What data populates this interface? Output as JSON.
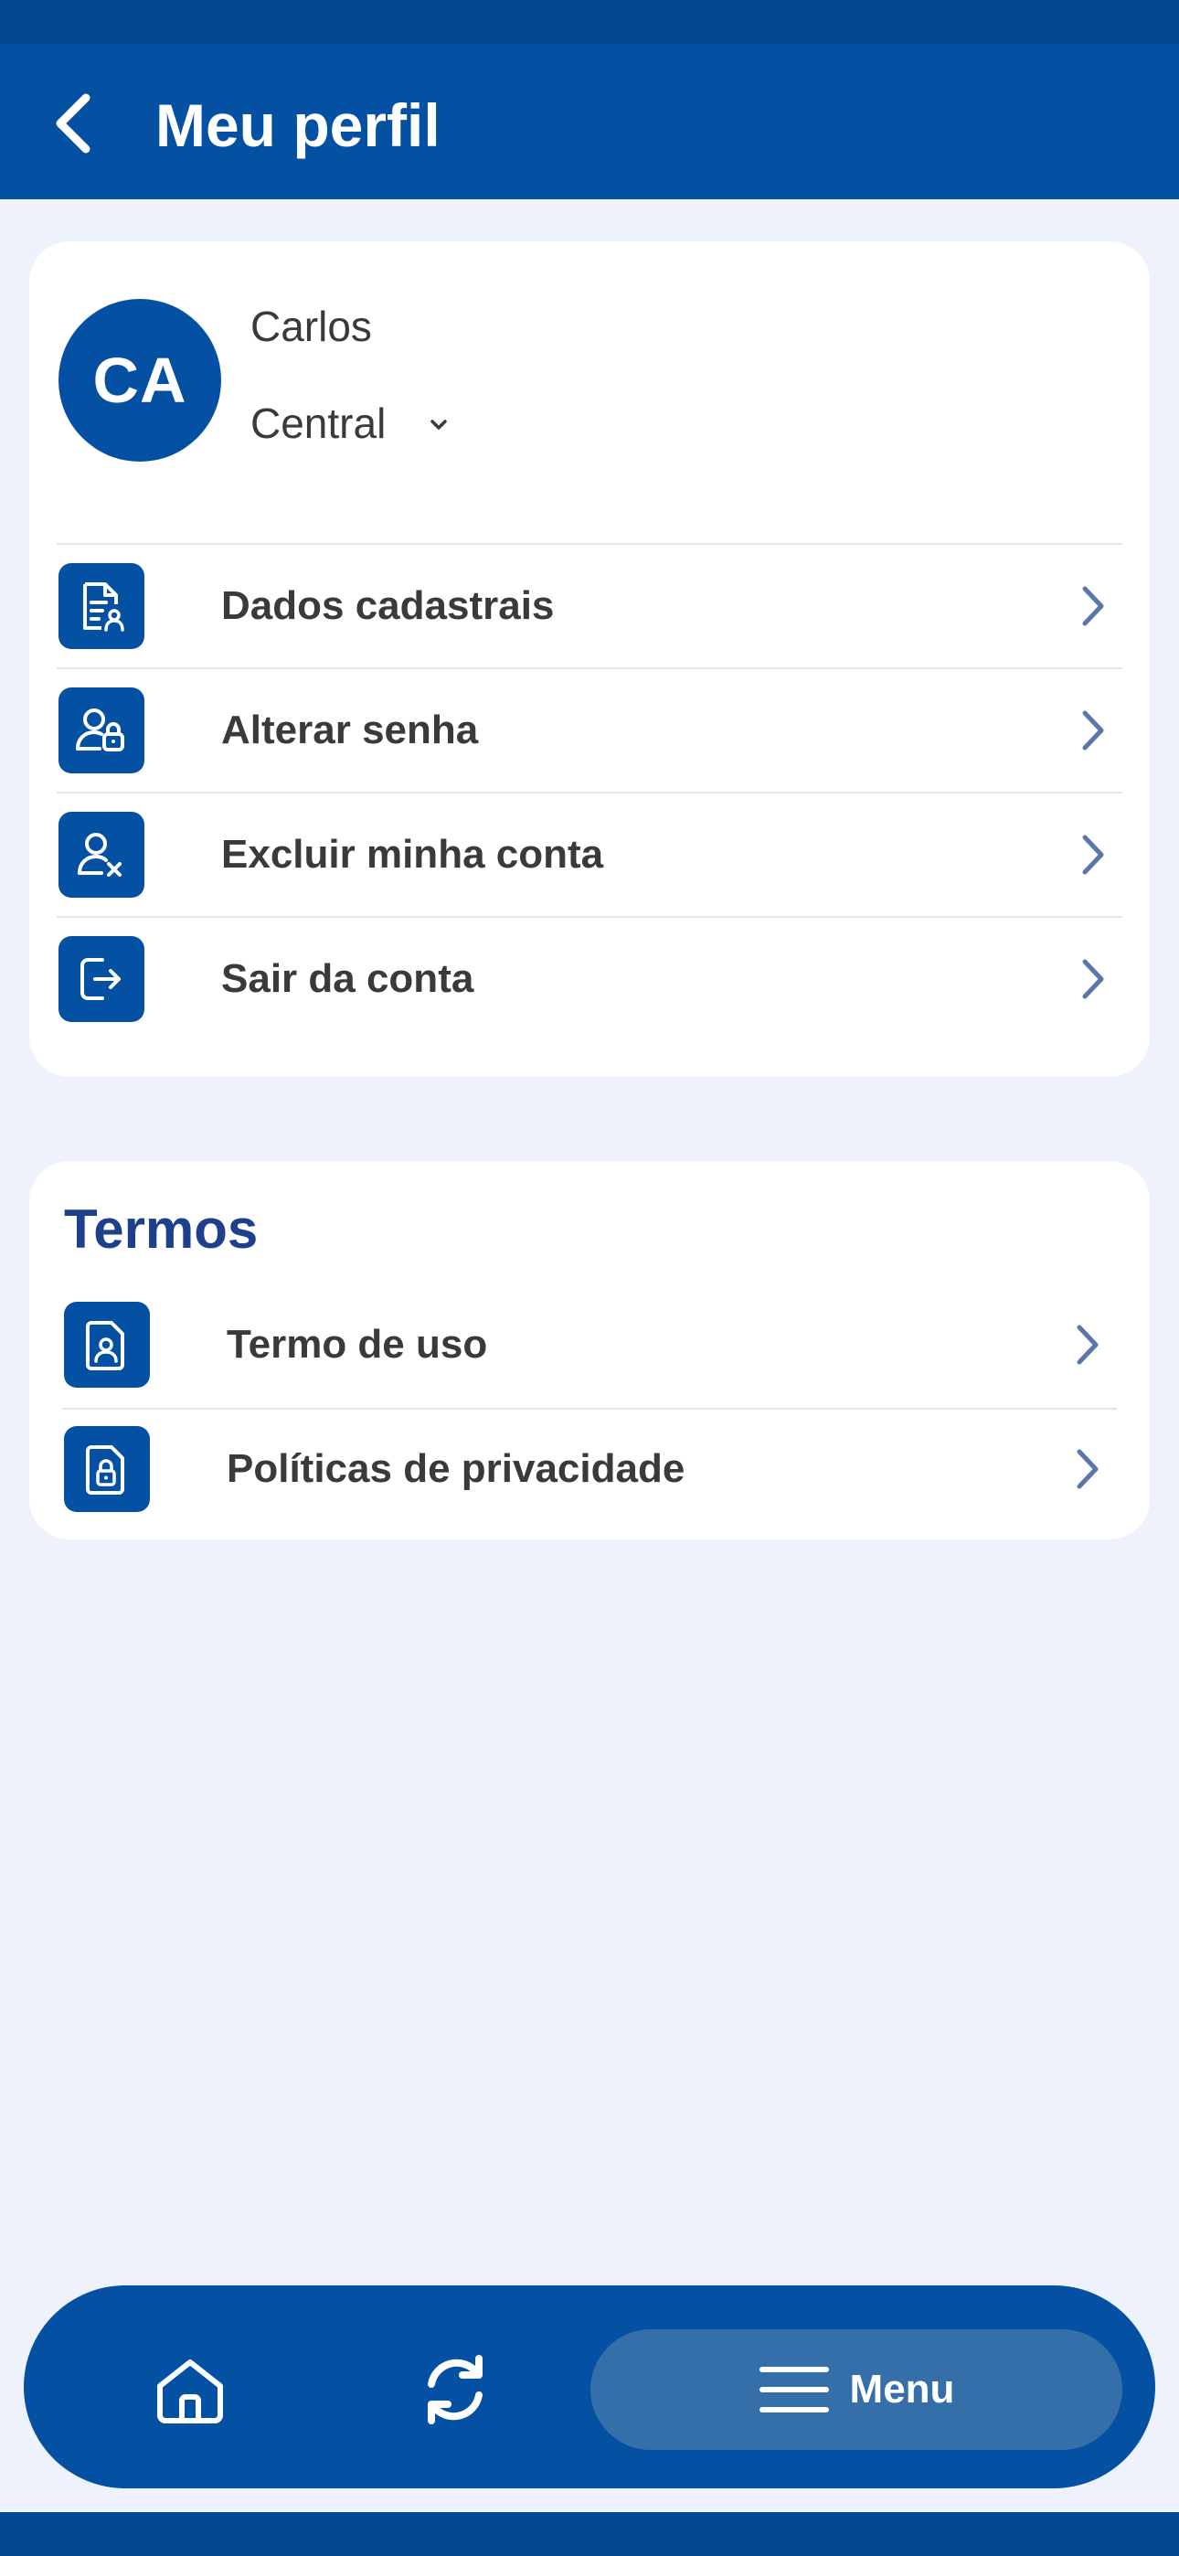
{
  "header": {
    "title": "Meu perfil"
  },
  "profile": {
    "initials": "CA",
    "name": "Carlos",
    "unit": "Central"
  },
  "account_menu": [
    {
      "label": "Dados cadastrais",
      "icon": "document-user-icon"
    },
    {
      "label": "Alterar senha",
      "icon": "user-lock-icon"
    },
    {
      "label": "Excluir minha conta",
      "icon": "user-remove-icon"
    },
    {
      "label": "Sair da conta",
      "icon": "logout-icon"
    }
  ],
  "terms": {
    "title": "Termos",
    "items": [
      {
        "label": "Termo de uso",
        "icon": "document-user-icon"
      },
      {
        "label": "Políticas de privacidade",
        "icon": "document-lock-icon"
      }
    ]
  },
  "bottom_nav": {
    "home_icon": "home-icon",
    "refresh_icon": "refresh-icon",
    "menu_label": "Menu"
  },
  "colors": {
    "primary": "#0451a4",
    "background": "#eef2fc",
    "title_blue": "#1e3f8c",
    "arrow": "#5b77a7"
  }
}
